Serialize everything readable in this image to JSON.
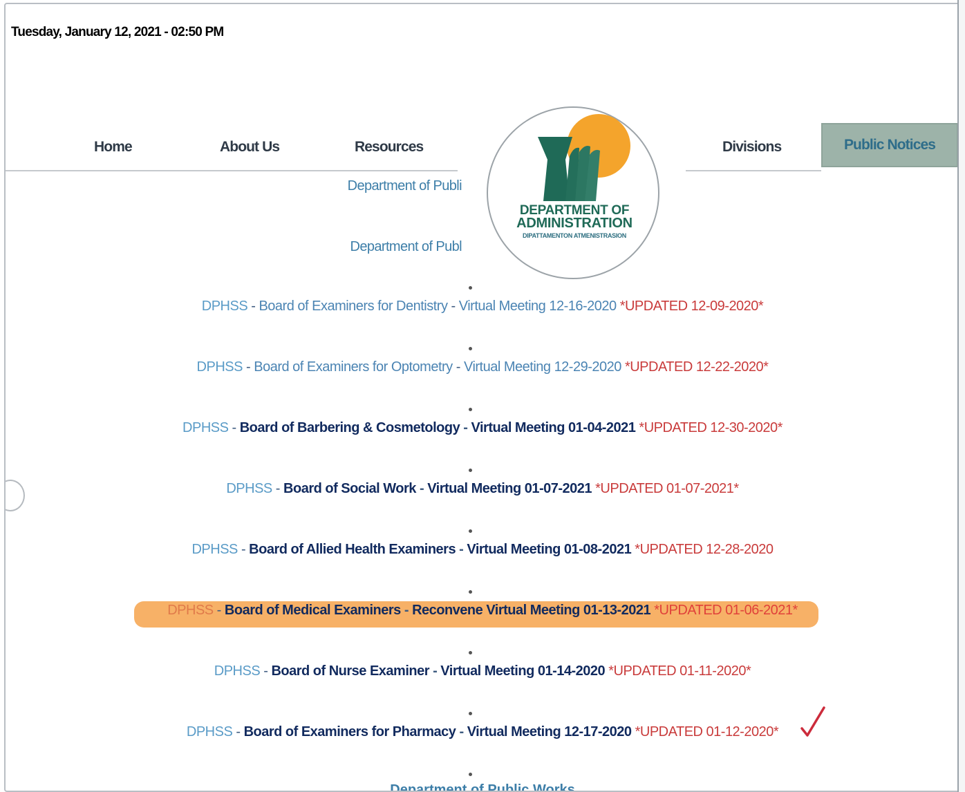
{
  "header": {
    "datetime": "Tuesday, January 12, 2021 - 02:50 PM"
  },
  "nav": {
    "home": "Home",
    "about": "About Us",
    "resources": "Resources",
    "divisions": "Divisions",
    "public_notices": "Public Notices"
  },
  "logo": {
    "line1": "DEPARTMENT OF",
    "line2": "ADMINISTRATION",
    "line3": "DIPATTAMENTON ATMENISTRASION"
  },
  "submenu": [
    {
      "label": "Department of Publi"
    },
    {
      "label": "Department of Publ"
    }
  ],
  "notices": [
    {
      "prefix": "DPHSS",
      "title": "Board of Examiners for Dentistry",
      "meeting": "Virtual Meeting 12-16-2020",
      "updated": "*UPDATED 12-09-2020*",
      "style": "light"
    },
    {
      "prefix": "DPHSS",
      "title": "Board of Examiners for Optometry",
      "meeting": "Virtual Meeting 12-29-2020",
      "updated": "*UPDATED 12-22-2020*",
      "style": "light"
    },
    {
      "prefix": "DPHSS",
      "title": "Board of Barbering & Cosmetology",
      "meeting": "Virtual Meeting 01-04-2021",
      "updated": "*UPDATED 12-30-2020*",
      "style": "bold"
    },
    {
      "prefix": "DPHSS",
      "title": "Board of Social Work",
      "meeting": "Virtual Meeting 01-07-2021",
      "updated": "*UPDATED 01-07-2021*",
      "style": "bold"
    },
    {
      "prefix": "DPHSS",
      "title": "Board of Allied Health Examiners",
      "meeting": "Virtual Meeting 01-08-2021",
      "updated": "*UPDATED 12-28-2020",
      "style": "bold"
    },
    {
      "prefix": "DPHSS",
      "title": "Board of Medical Examiners",
      "meeting": "Reconvene Virtual Meeting 01-13-2021",
      "updated": "*UPDATED 01-06-2021*",
      "style": "bold"
    },
    {
      "prefix": "DPHSS",
      "title": "Board of Nurse Examiner",
      "meeting": "Virtual Meeting 01-14-2020",
      "updated": "*UPDATED 01-11-2020*",
      "style": "bold"
    },
    {
      "prefix": "DPHSS",
      "title": "Board of Examiners for Pharmacy",
      "meeting": "Virtual Meeting 12-17-2020",
      "updated": "*UPDATED 01-12-2020*",
      "style": "bold"
    }
  ],
  "footer_link": "Department of Public Works",
  "colors": {
    "nav_active_bg": "#9db3a9",
    "highlight": "#f7b167",
    "updated_red": "#c93b3b",
    "logo_green": "#1f6a57",
    "logo_sun": "#f4a42c"
  }
}
